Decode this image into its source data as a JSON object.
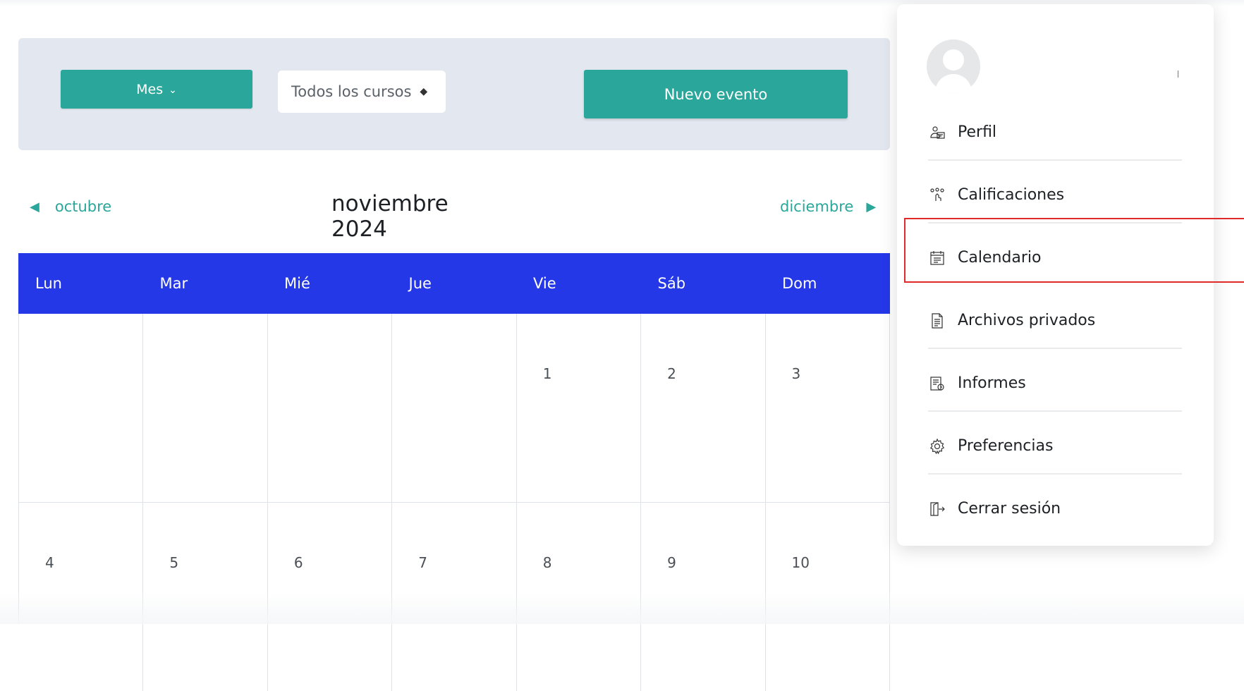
{
  "toolbar": {
    "view_button_label": "Mes",
    "course_select_value": "Todos los cursos",
    "new_event_label": "Nuevo evento"
  },
  "calendar": {
    "prev_month": "octubre",
    "current_month": "noviembre 2024",
    "next_month": "diciembre",
    "weekdays": [
      "Lun",
      "Mar",
      "Mié",
      "Jue",
      "Vie",
      "Sáb",
      "Dom"
    ],
    "weeks": [
      [
        "",
        "",
        "",
        "",
        "1",
        "2",
        "3"
      ],
      [
        "4",
        "5",
        "6",
        "7",
        "8",
        "9",
        "10"
      ]
    ]
  },
  "user_menu": {
    "items": [
      {
        "label": "Perfil",
        "icon": "profile-icon"
      },
      {
        "label": "Calificaciones",
        "icon": "grades-icon"
      },
      {
        "label": "Calendario",
        "icon": "calendar-icon"
      },
      {
        "label": "Archivos privados",
        "icon": "file-icon"
      },
      {
        "label": "Informes",
        "icon": "reports-icon"
      },
      {
        "label": "Preferencias",
        "icon": "gear-icon"
      },
      {
        "label": "Cerrar sesión",
        "icon": "logout-icon"
      }
    ]
  },
  "colors": {
    "accent": "#2aa79a",
    "calendar_header": "#2538e8",
    "highlight": "#e02a2a"
  }
}
